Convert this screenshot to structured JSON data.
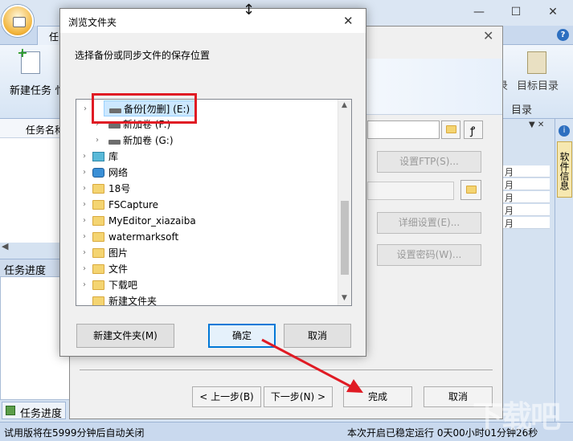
{
  "app": {
    "tab_task": "任",
    "new_task_label": "新建任务",
    "ribbon_edge_glyph": "忄",
    "ribbon_right_a": "录",
    "ribbon_right_b": "目标目录",
    "ribbon_group_label": "目录",
    "task_name_col": "任务名称",
    "task_progress_title": "任务进度",
    "task_progress_tab": "任务进度",
    "status_left": "试用版将在5999分钟后自动关闭",
    "status_right": "本次开启已稳定运行 0天00小时01分钟26秒",
    "side_info_tab": "软件信息",
    "right_pane_pin": "▼ ✕",
    "grid_rows": [
      "月",
      "月",
      "月",
      "月",
      "月"
    ],
    "win_min": "—",
    "win_max": "☐",
    "win_close": "✕",
    "help": "?",
    "side_info_icon": "i",
    "hscroll_left": "◀"
  },
  "wizard": {
    "close": "✕",
    "ftp_button": "设置FTP(S)...",
    "detail_button": "详细设置(E)...",
    "password_button": "设置密码(W)...",
    "prev_button": "< 上一步(B)",
    "next_button": "下一步(N) >",
    "finish_button": "完成",
    "cancel_button": "取消",
    "key_glyph": "ꝭ"
  },
  "browse": {
    "title": "浏览文件夹",
    "close": "✕",
    "prompt": "选择备份或同步文件的保存位置",
    "tree": [
      {
        "label": "备份[勿删] (E:)",
        "type": "drive",
        "selected": true
      },
      {
        "label": "新加卷 (F:)",
        "type": "drive"
      },
      {
        "label": "新加卷 (G:)",
        "type": "drive"
      },
      {
        "label": "库",
        "type": "library"
      },
      {
        "label": "网络",
        "type": "network"
      },
      {
        "label": "18号",
        "type": "folder"
      },
      {
        "label": "FSCapture",
        "type": "folder"
      },
      {
        "label": "MyEditor_xiazaiba",
        "type": "folder"
      },
      {
        "label": "watermarksoft",
        "type": "folder"
      },
      {
        "label": "图片",
        "type": "folder"
      },
      {
        "label": "文件",
        "type": "folder"
      },
      {
        "label": "下载吧",
        "type": "folder"
      },
      {
        "label": "新建文件夹",
        "type": "folder"
      }
    ],
    "new_folder_button": "新建文件夹(M)",
    "ok_button": "确定",
    "cancel_button": "取消",
    "scroll_up": "▲",
    "scroll_down": "▼"
  },
  "colors": {
    "highlight": "#e01b24",
    "arrow": "#e01b24",
    "selection": "#cce8ff",
    "focus_border": "#0078d7"
  },
  "overlay": {
    "watermark": "下载吧"
  }
}
